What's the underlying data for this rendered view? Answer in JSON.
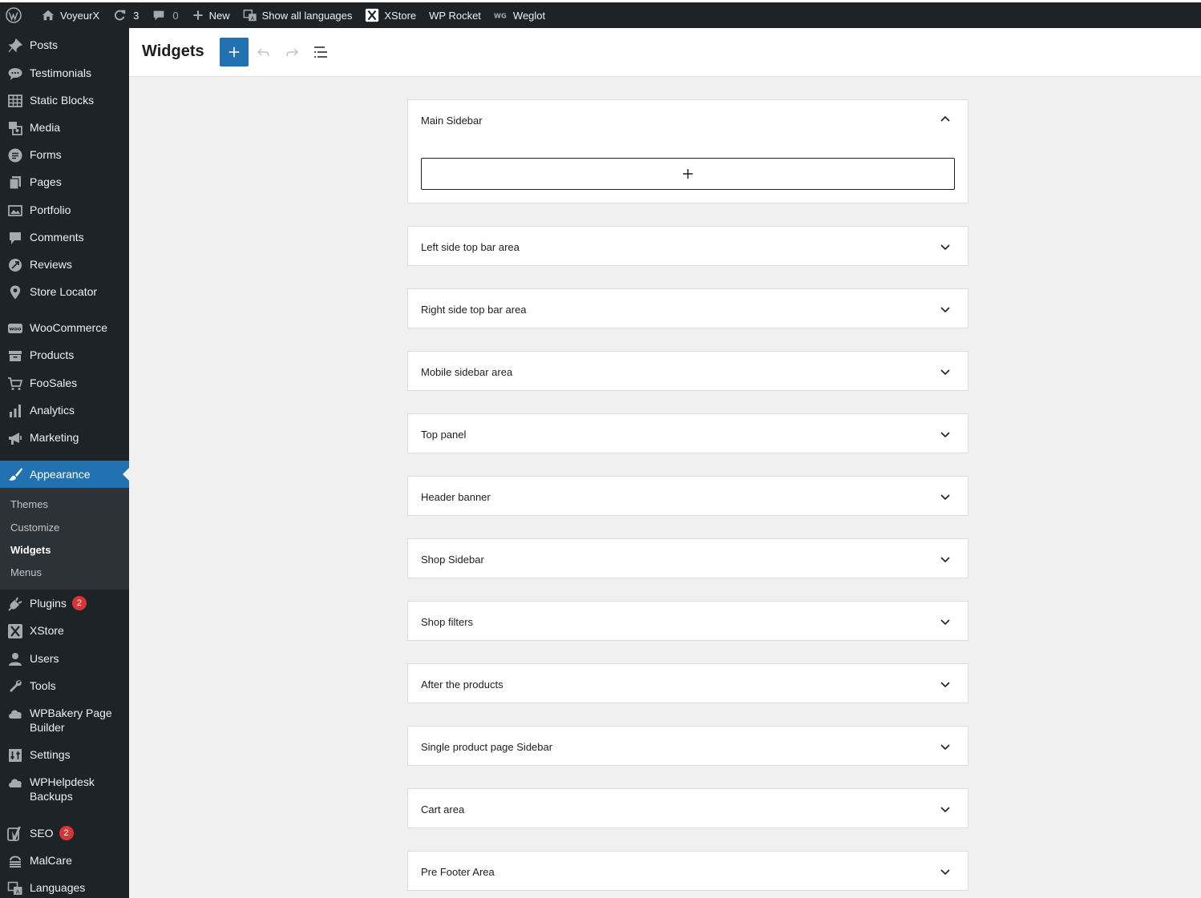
{
  "adminbar": {
    "site_name": "VoyeurX",
    "updates_count": "3",
    "comments_count": "0",
    "new_label": "New",
    "languages_label": "Show all languages",
    "xstore_label": "XStore",
    "wprocket_label": "WP Rocket",
    "weglot_label": "Weglot"
  },
  "sidebar": {
    "items": [
      {
        "label": "Posts",
        "icon": "pin-icon"
      },
      {
        "label": "Testimonials",
        "icon": "speech-bubbles-icon"
      },
      {
        "label": "Static Blocks",
        "icon": "grid-icon"
      },
      {
        "label": "Media",
        "icon": "media-icon"
      },
      {
        "label": "Forms",
        "icon": "forms-icon"
      },
      {
        "label": "Pages",
        "icon": "pages-icon"
      },
      {
        "label": "Portfolio",
        "icon": "portfolio-icon"
      },
      {
        "label": "Comments",
        "icon": "comment-icon"
      },
      {
        "label": "Reviews",
        "icon": "reviews-icon"
      },
      {
        "label": "Store Locator",
        "icon": "location-pin-icon"
      },
      {
        "label": "WooCommerce",
        "icon": "woo-icon"
      },
      {
        "label": "Products",
        "icon": "archive-icon"
      },
      {
        "label": "FooSales",
        "icon": "cart-icon"
      },
      {
        "label": "Analytics",
        "icon": "bar-chart-icon"
      },
      {
        "label": "Marketing",
        "icon": "megaphone-icon"
      },
      {
        "label": "Appearance",
        "icon": "paintbrush-icon"
      },
      {
        "label": "Plugins",
        "icon": "plug-icon",
        "badge": "2"
      },
      {
        "label": "XStore",
        "icon": "xstore-icon"
      },
      {
        "label": "Users",
        "icon": "user-icon"
      },
      {
        "label": "Tools",
        "icon": "wrench-icon"
      },
      {
        "label": "WPBakery Page Builder",
        "icon": "cloud-icon"
      },
      {
        "label": "Settings",
        "icon": "settings-icon"
      },
      {
        "label": "WPHelpdesk Backups",
        "icon": "cloud-icon"
      },
      {
        "label": "SEO",
        "icon": "yoast-icon",
        "badge": "2"
      },
      {
        "label": "MalCare",
        "icon": "malcare-icon"
      },
      {
        "label": "Languages",
        "icon": "translate-icon"
      }
    ],
    "submenu": [
      "Themes",
      "Customize",
      "Widgets",
      "Menus"
    ]
  },
  "header": {
    "title": "Widgets"
  },
  "widget_areas": [
    {
      "title": "Main Sidebar",
      "expanded": true
    },
    {
      "title": "Left side top bar area"
    },
    {
      "title": "Right side top bar area"
    },
    {
      "title": "Mobile sidebar area"
    },
    {
      "title": "Top panel"
    },
    {
      "title": "Header banner"
    },
    {
      "title": "Shop Sidebar"
    },
    {
      "title": "Shop filters"
    },
    {
      "title": "After the products"
    },
    {
      "title": "Single product page Sidebar"
    },
    {
      "title": "Cart area"
    },
    {
      "title": "Pre Footer Area"
    }
  ],
  "colors": {
    "accent": "#2271b1",
    "sidebar_bg": "#1d2327",
    "badge": "#d63638"
  }
}
